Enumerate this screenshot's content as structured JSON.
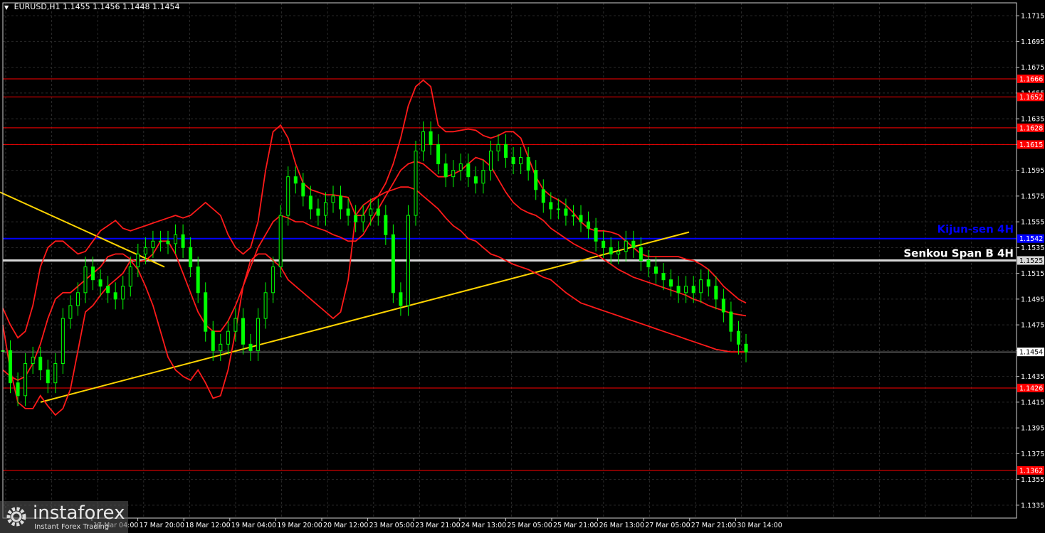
{
  "header": {
    "symbol": "EURUSD,H1",
    "ohlc": "1.1455 1.1456 1.1448 1.1454"
  },
  "logo": {
    "brand": "instaforex",
    "tagline": "Instant Forex Trading"
  },
  "colors": {
    "background": "#000000",
    "candle": "#00ff00",
    "grid": "#2a2a2a",
    "level": "#ff0000",
    "bollinger": "#ff1a1a",
    "kijun": "#0000ff",
    "senkou": "#d8d8d8",
    "trendline": "#ffd400",
    "axis_text": "#ffffff"
  },
  "chart_data": {
    "type": "line",
    "title": "EURUSD,H1",
    "ylim": [
      1.1325,
      1.1725
    ],
    "y_ticks": [
      "1.1715",
      "1.1695",
      "1.1675",
      "1.1655",
      "1.1635",
      "1.1615",
      "1.1595",
      "1.1575",
      "1.1555",
      "1.1535",
      "1.1515",
      "1.1495",
      "1.1475",
      "1.1455",
      "1.1435",
      "1.1415",
      "1.1395",
      "1.1375",
      "1.1355",
      "1.1335"
    ],
    "x_ticks": [
      "17 Mar 04:00",
      "17 Mar 20:00",
      "18 Mar 12:00",
      "19 Mar 04:00",
      "19 Mar 20:00",
      "20 Mar 12:00",
      "23 Mar 05:00",
      "23 Mar 21:00",
      "24 Mar 13:00",
      "25 Mar 05:00",
      "25 Mar 21:00",
      "26 Mar 13:00",
      "27 Mar 05:00",
      "27 Mar 21:00",
      "30 Mar 14:00"
    ],
    "horizontal_levels": [
      {
        "value": 1.1666,
        "label": "1.1666"
      },
      {
        "value": 1.1652,
        "label": "1.1652"
      },
      {
        "value": 1.1628,
        "label": "1.1628"
      },
      {
        "value": 1.1615,
        "label": "1.1615"
      },
      {
        "value": 1.1426,
        "label": "1.1426"
      },
      {
        "value": 1.1362,
        "label": "1.1362"
      }
    ],
    "kijun_sen": {
      "value": 1.1542,
      "label": "1.1542",
      "name": "Kijun-sen 4H"
    },
    "senkou_span_b": {
      "value": 1.1525,
      "label": "1.1525",
      "name": "Senkou Span B 4H"
    },
    "current_price": {
      "value": 1.1454,
      "label": "1.1454"
    },
    "trend_lines": [
      {
        "from": [
          0,
          1.1578
        ],
        "to": [
          231,
          1.152
        ]
      },
      {
        "from": [
          57,
          1.1415
        ],
        "to": [
          968,
          1.1547
        ]
      }
    ],
    "price": [
      1.1455,
      1.143,
      1.142,
      1.1445,
      1.145,
      1.144,
      1.143,
      1.1445,
      1.148,
      1.149,
      1.15,
      1.152,
      1.151,
      1.1505,
      1.15,
      1.1495,
      1.1505,
      1.152,
      1.153,
      1.1535,
      1.154,
      1.154,
      1.1538,
      1.1545,
      1.1535,
      1.152,
      1.15,
      1.147,
      1.1455,
      1.146,
      1.147,
      1.148,
      1.146,
      1.1455,
      1.148,
      1.15,
      1.152,
      1.156,
      1.159,
      1.1585,
      1.1575,
      1.1565,
      1.156,
      1.157,
      1.1575,
      1.1565,
      1.156,
      1.1555,
      1.156,
      1.1565,
      1.156,
      1.1545,
      1.15,
      1.149,
      1.156,
      1.161,
      1.1625,
      1.1615,
      1.16,
      1.159,
      1.1595,
      1.16,
      1.159,
      1.1585,
      1.1595,
      1.161,
      1.1615,
      1.1605,
      1.16,
      1.1605,
      1.1595,
      1.158,
      1.157,
      1.1565,
      1.1565,
      1.156,
      1.156,
      1.1555,
      1.155,
      1.154,
      1.1535,
      1.153,
      1.1532,
      1.154,
      1.1535,
      1.1525,
      1.152,
      1.1515,
      1.151,
      1.1505,
      1.15,
      1.1505,
      1.15,
      1.151,
      1.1505,
      1.1495,
      1.1485,
      1.147,
      1.146,
      1.1454
    ],
    "bollinger_upper": [
      1.1488,
      1.1475,
      1.1465,
      1.147,
      1.149,
      1.152,
      1.1535,
      1.154,
      1.154,
      1.1535,
      1.153,
      1.1532,
      1.154,
      1.1548,
      1.1552,
      1.1556,
      1.155,
      1.1548,
      1.155,
      1.1552,
      1.1554,
      1.1556,
      1.1558,
      1.156,
      1.1558,
      1.156,
      1.1565,
      1.157,
      1.1565,
      1.156,
      1.1545,
      1.1535,
      1.153,
      1.1535,
      1.1555,
      1.1595,
      1.1625,
      1.163,
      1.162,
      1.16,
      1.1585,
      1.158,
      1.1578,
      1.1576,
      1.1576,
      1.1575,
      1.1574,
      1.156,
      1.156,
      1.157,
      1.1575,
      1.1585,
      1.16,
      1.162,
      1.1645,
      1.166,
      1.1665,
      1.166,
      1.163,
      1.1625,
      1.1625,
      1.1626,
      1.1627,
      1.1626,
      1.1622,
      1.162,
      1.1622,
      1.1625,
      1.1625,
      1.162,
      1.1605,
      1.159,
      1.158,
      1.1575,
      1.1572,
      1.1568,
      1.1562,
      1.1555,
      1.155,
      1.1548,
      1.1548,
      1.1547,
      1.1545,
      1.154,
      1.1535,
      1.153,
      1.1528,
      1.1528,
      1.1528,
      1.1528,
      1.1528,
      1.1526,
      1.1525,
      1.1522,
      1.1518,
      1.1512,
      1.1505,
      1.15,
      1.1495,
      1.1492
    ],
    "bollinger_middle": [
      1.144,
      1.1435,
      1.1432,
      1.1435,
      1.1445,
      1.146,
      1.148,
      1.1495,
      1.15,
      1.15,
      1.1505,
      1.151,
      1.1515,
      1.152,
      1.1528,
      1.153,
      1.153,
      1.1526,
      1.1524,
      1.1525,
      1.153,
      1.154,
      1.154,
      1.153,
      1.1515,
      1.15,
      1.1485,
      1.1475,
      1.147,
      1.147,
      1.1478,
      1.149,
      1.1505,
      1.152,
      1.1535,
      1.1545,
      1.1555,
      1.156,
      1.1558,
      1.1555,
      1.1555,
      1.1552,
      1.155,
      1.1548,
      1.1545,
      1.1543,
      1.154,
      1.154,
      1.1545,
      1.1555,
      1.1565,
      1.1575,
      1.1585,
      1.1595,
      1.16,
      1.1602,
      1.16,
      1.1595,
      1.159,
      1.159,
      1.1592,
      1.1595,
      1.16,
      1.1605,
      1.1603,
      1.1598,
      1.1588,
      1.1578,
      1.157,
      1.1565,
      1.1562,
      1.156,
      1.1556,
      1.155,
      1.1546,
      1.1542,
      1.1538,
      1.1535,
      1.1532,
      1.153,
      1.1526,
      1.1522,
      1.1518,
      1.1515,
      1.1512,
      1.151,
      1.1508,
      1.1506,
      1.1504,
      1.1502,
      1.15,
      1.1498,
      1.1495,
      1.1493,
      1.149,
      1.1488,
      1.1486,
      1.1484,
      1.1483,
      1.1482
    ],
    "bollinger_lower": [
      1.1475,
      1.144,
      1.1415,
      1.141,
      1.141,
      1.142,
      1.1412,
      1.1405,
      1.141,
      1.1425,
      1.1455,
      1.1485,
      1.149,
      1.1498,
      1.1505,
      1.151,
      1.1515,
      1.1525,
      1.1518,
      1.1505,
      1.149,
      1.147,
      1.145,
      1.144,
      1.1435,
      1.1432,
      1.144,
      1.143,
      1.1418,
      1.142,
      1.144,
      1.147,
      1.1505,
      1.1525,
      1.153,
      1.153,
      1.1525,
      1.152,
      1.151,
      1.1505,
      1.15,
      1.1495,
      1.149,
      1.1485,
      1.148,
      1.1485,
      1.151,
      1.156,
      1.1568,
      1.1572,
      1.1575,
      1.1578,
      1.158,
      1.1582,
      1.1582,
      1.158,
      1.1575,
      1.157,
      1.1565,
      1.1558,
      1.1552,
      1.1548,
      1.1542,
      1.154,
      1.1535,
      1.153,
      1.1528,
      1.1525,
      1.1522,
      1.152,
      1.1518,
      1.1515,
      1.1512,
      1.151,
      1.1505,
      1.15,
      1.1496,
      1.1492,
      1.149,
      1.1488,
      1.1486,
      1.1484,
      1.1482,
      1.148,
      1.1478,
      1.1476,
      1.1474,
      1.1472,
      1.147,
      1.1468,
      1.1466,
      1.1464,
      1.1462,
      1.146,
      1.1458,
      1.1456,
      1.1455,
      1.1454,
      1.1454,
      1.1454
    ]
  }
}
